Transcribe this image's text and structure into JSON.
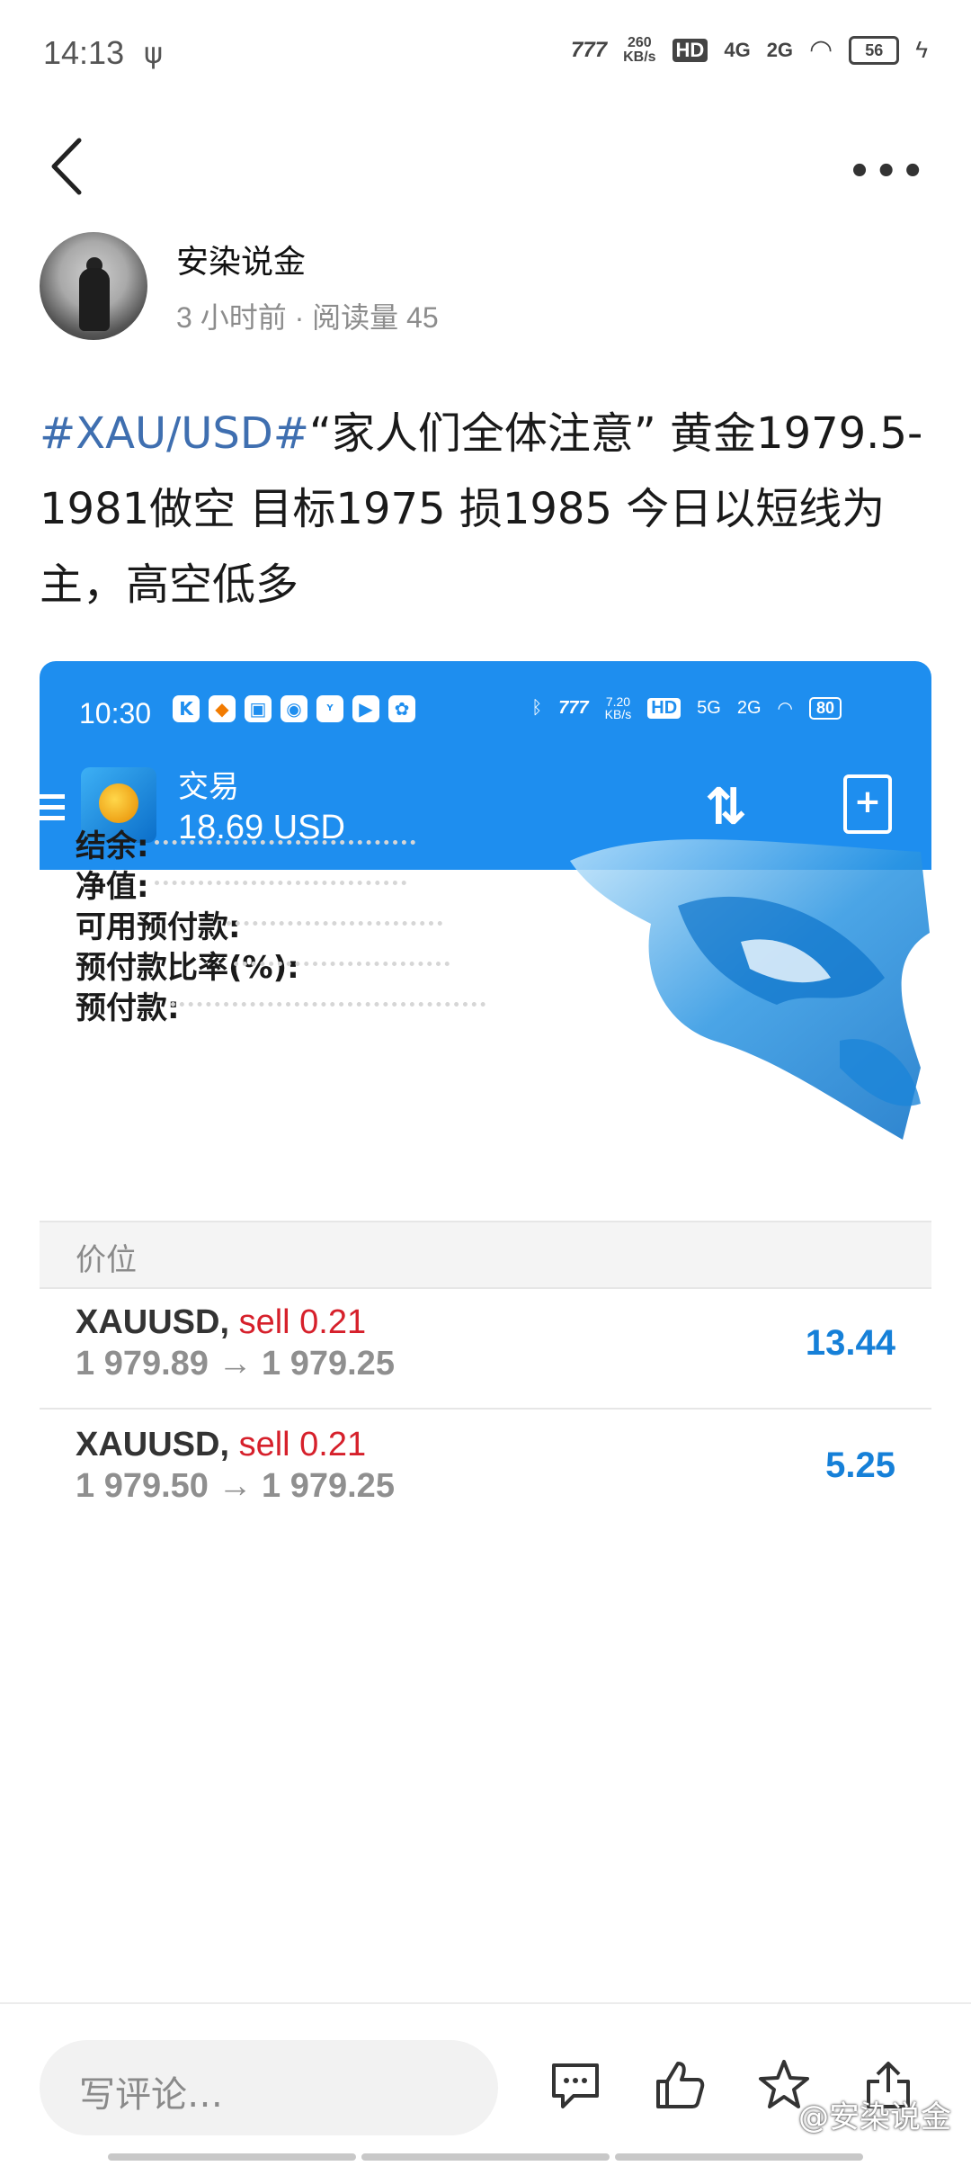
{
  "status_bar": {
    "time": "14:13",
    "speed": "260\nKB/s",
    "net1": "4G",
    "net2": "2G",
    "battery": "56"
  },
  "author": {
    "name": "安染说金",
    "meta": "3 小时前 · 阅读量 45"
  },
  "post": {
    "hashtag": "#XAU/USD#",
    "text": "“家人们全体注意” 黄金1979.5-1981做空 目标1975 损1985 今日以短线为主，高空低多"
  },
  "screenshot": {
    "time": "10:30",
    "speed": "7.20\nKB/s",
    "net1": "5G",
    "net2": "2G",
    "battery": "80",
    "title": "交易",
    "amount": "18.69 USD",
    "account_rows": [
      {
        "label": "结余:"
      },
      {
        "label": "净值:"
      },
      {
        "label": "可用预付款:"
      },
      {
        "label": "预付款比率(%):"
      },
      {
        "label": "预付款:"
      }
    ],
    "price_header": "价位",
    "trades": [
      {
        "symbol": "XAUUSD,",
        "side": "sell 0.21",
        "prices": "1 979.89 → 1 979.25",
        "profit": "13.44"
      },
      {
        "symbol": "XAUUSD,",
        "side": "sell 0.21",
        "prices": "1 979.50 → 1 979.25",
        "profit": "5.25"
      }
    ]
  },
  "bottom_bar": {
    "comment_placeholder": "写评论…",
    "watermark": "@安染说金"
  },
  "colors": {
    "hashtag": "#3f6fb0",
    "mt_blue": "#1e8eef",
    "sell_red": "#d6202b",
    "profit_blue": "#1680d8"
  }
}
